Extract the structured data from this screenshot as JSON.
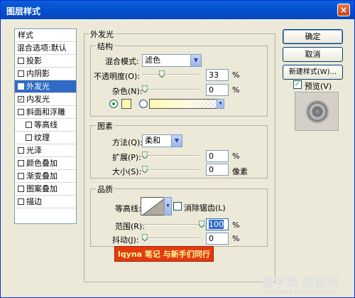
{
  "window": {
    "title": "图层样式",
    "close_label": "×"
  },
  "style_list": {
    "header": "样式",
    "items": [
      {
        "label": "混合选项:默认",
        "has_checkbox": false,
        "checked": false,
        "selected": false,
        "indent": 0
      },
      {
        "label": "投影",
        "has_checkbox": true,
        "checked": false,
        "selected": false,
        "indent": 0
      },
      {
        "label": "内阴影",
        "has_checkbox": true,
        "checked": false,
        "selected": false,
        "indent": 0
      },
      {
        "label": "外发光",
        "has_checkbox": true,
        "checked": true,
        "selected": true,
        "indent": 0
      },
      {
        "label": "内发光",
        "has_checkbox": true,
        "checked": true,
        "selected": false,
        "indent": 0
      },
      {
        "label": "斜面和浮雕",
        "has_checkbox": true,
        "checked": false,
        "selected": false,
        "indent": 0
      },
      {
        "label": "等高线",
        "has_checkbox": true,
        "checked": false,
        "selected": false,
        "indent": 1
      },
      {
        "label": "纹理",
        "has_checkbox": true,
        "checked": false,
        "selected": false,
        "indent": 1
      },
      {
        "label": "光泽",
        "has_checkbox": true,
        "checked": false,
        "selected": false,
        "indent": 0
      },
      {
        "label": "颜色叠加",
        "has_checkbox": true,
        "checked": false,
        "selected": false,
        "indent": 0
      },
      {
        "label": "渐变叠加",
        "has_checkbox": true,
        "checked": false,
        "selected": false,
        "indent": 0
      },
      {
        "label": "图案叠加",
        "has_checkbox": true,
        "checked": false,
        "selected": false,
        "indent": 0
      },
      {
        "label": "描边",
        "has_checkbox": true,
        "checked": false,
        "selected": false,
        "indent": 0
      }
    ]
  },
  "outer_glow": {
    "title": "外发光",
    "structure": {
      "title": "结构",
      "blend_mode_label": "混合模式:",
      "blend_mode_value": "滤色",
      "opacity_label": "不透明度(O):",
      "opacity_value": "33",
      "opacity_fraction": 0.33,
      "noise_label": "杂色(N):",
      "noise_value": "0",
      "noise_fraction": 0,
      "percent": "%",
      "color_hex": "#ffffb0"
    },
    "elements": {
      "title": "图素",
      "method_label": "方法(Q):",
      "method_value": "柔和",
      "spread_label": "扩展(P):",
      "spread_value": "0",
      "spread_fraction": 0,
      "size_label": "大小(S):",
      "size_value": "0",
      "size_fraction": 0,
      "percent": "%",
      "px_unit": "像素"
    },
    "quality": {
      "title": "品质",
      "contour_label": "等高线:",
      "antialias_label": "消除锯齿(L)",
      "antialias_checked": false,
      "range_label": "范围(R):",
      "range_value": "100",
      "range_fraction": 1,
      "jitter_label": "抖动(J):",
      "jitter_value": "0",
      "jitter_fraction": 0,
      "percent": "%"
    }
  },
  "buttons": {
    "ok": "确定",
    "cancel": "取消",
    "new_style": "新建样式(W)...",
    "preview_label": "预览(V)",
    "preview_checked": true
  },
  "watermarks": {
    "banner": "lqyna 笔记 与新手们同行",
    "site": "查字典 教程网",
    "url": "jiaocheng.chazidian.com"
  }
}
